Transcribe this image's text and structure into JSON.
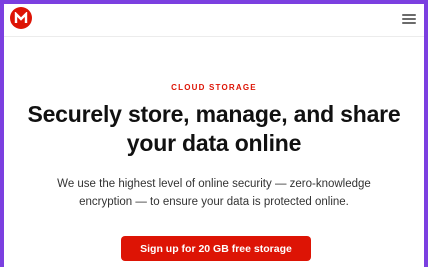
{
  "header": {
    "logo_icon": "mega-logo-icon",
    "menu_icon": "hamburger-menu-icon"
  },
  "hero": {
    "eyebrow": "CLOUD STORAGE",
    "headline": "Securely store, manage, and share your data online",
    "description": "We use the highest level of online security — zero-knowledge encryption — to ensure your data is protected online.",
    "cta_label": "Sign up for 20 GB free storage"
  },
  "colors": {
    "brand": "#dd1405",
    "frame": "#7b3fe0",
    "text": "#111111"
  }
}
